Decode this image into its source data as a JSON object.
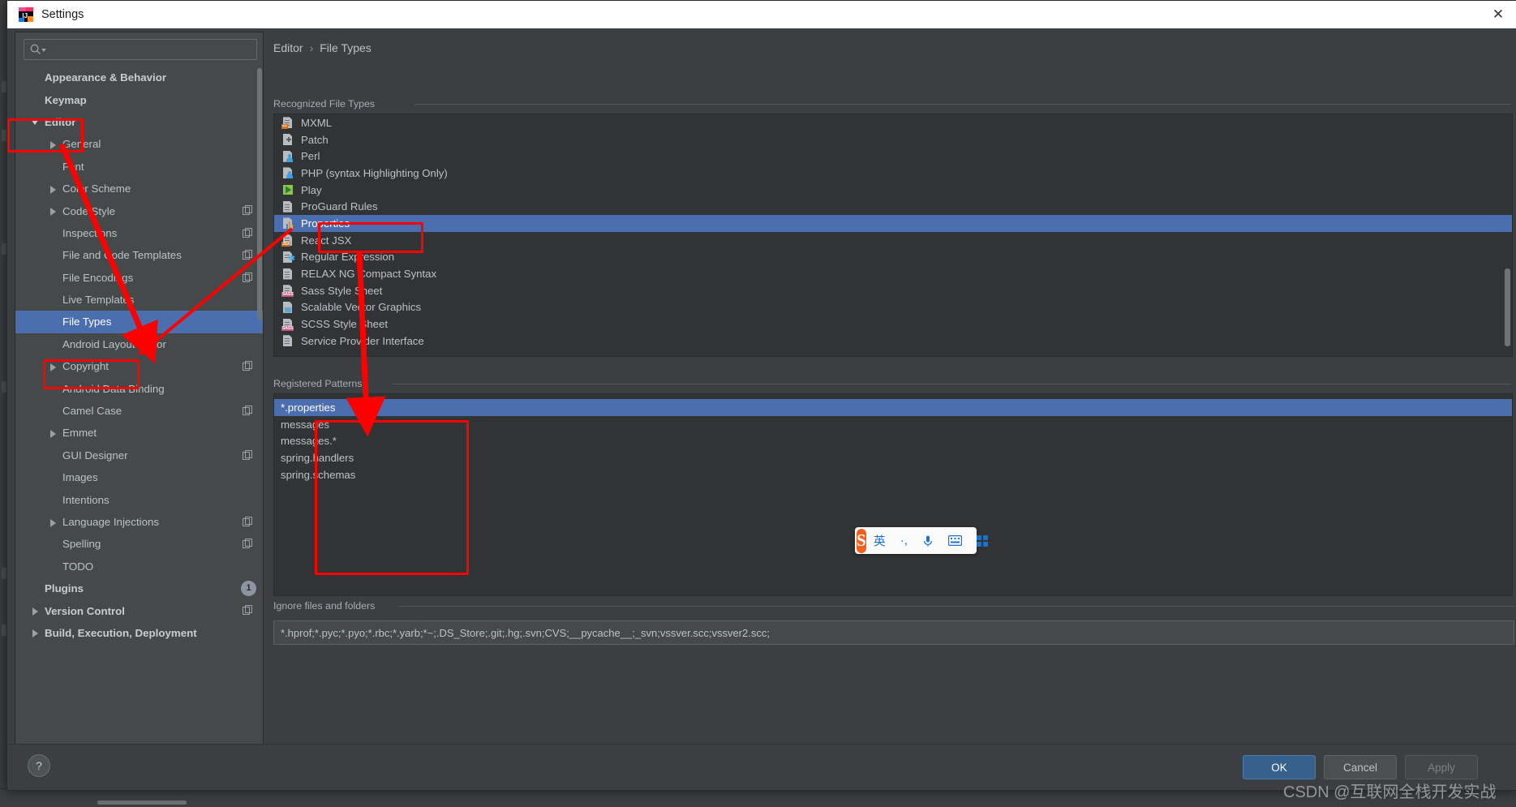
{
  "window": {
    "title": "Settings",
    "app_icon": "intellij-idea-icon",
    "close_icon": "close-icon"
  },
  "search": {
    "placeholder": "",
    "value": "",
    "icon": "search-icon"
  },
  "sidebar": {
    "items": [
      {
        "label": "Appearance & Behavior",
        "indent": 0,
        "bold": true,
        "arrow": "none",
        "copy": false
      },
      {
        "label": "Keymap",
        "indent": 0,
        "bold": true,
        "arrow": "none",
        "copy": false
      },
      {
        "label": "Editor",
        "indent": 0,
        "bold": true,
        "arrow": "down",
        "copy": false
      },
      {
        "label": "General",
        "indent": 1,
        "bold": false,
        "arrow": "right",
        "copy": false
      },
      {
        "label": "Font",
        "indent": 1,
        "bold": false,
        "arrow": "none",
        "copy": false
      },
      {
        "label": "Color Scheme",
        "indent": 1,
        "bold": false,
        "arrow": "right",
        "copy": false
      },
      {
        "label": "Code Style",
        "indent": 1,
        "bold": false,
        "arrow": "right",
        "copy": true
      },
      {
        "label": "Inspections",
        "indent": 1,
        "bold": false,
        "arrow": "none",
        "copy": true
      },
      {
        "label": "File and Code Templates",
        "indent": 1,
        "bold": false,
        "arrow": "none",
        "copy": true
      },
      {
        "label": "File Encodings",
        "indent": 1,
        "bold": false,
        "arrow": "none",
        "copy": true
      },
      {
        "label": "Live Templates",
        "indent": 1,
        "bold": false,
        "arrow": "none",
        "copy": false
      },
      {
        "label": "File Types",
        "indent": 1,
        "bold": false,
        "arrow": "none",
        "copy": false,
        "selected": true
      },
      {
        "label": "Android Layout Editor",
        "indent": 1,
        "bold": false,
        "arrow": "none",
        "copy": false
      },
      {
        "label": "Copyright",
        "indent": 1,
        "bold": false,
        "arrow": "right",
        "copy": true
      },
      {
        "label": "Android Data Binding",
        "indent": 1,
        "bold": false,
        "arrow": "none",
        "copy": false
      },
      {
        "label": "Camel Case",
        "indent": 1,
        "bold": false,
        "arrow": "none",
        "copy": true
      },
      {
        "label": "Emmet",
        "indent": 1,
        "bold": false,
        "arrow": "right",
        "copy": false
      },
      {
        "label": "GUI Designer",
        "indent": 1,
        "bold": false,
        "arrow": "none",
        "copy": true
      },
      {
        "label": "Images",
        "indent": 1,
        "bold": false,
        "arrow": "none",
        "copy": false
      },
      {
        "label": "Intentions",
        "indent": 1,
        "bold": false,
        "arrow": "none",
        "copy": false
      },
      {
        "label": "Language Injections",
        "indent": 1,
        "bold": false,
        "arrow": "right",
        "copy": true
      },
      {
        "label": "Spelling",
        "indent": 1,
        "bold": false,
        "arrow": "none",
        "copy": true
      },
      {
        "label": "TODO",
        "indent": 1,
        "bold": false,
        "arrow": "none",
        "copy": false
      },
      {
        "label": "Plugins",
        "indent": 0,
        "bold": true,
        "arrow": "none",
        "copy": false,
        "badge": "1"
      },
      {
        "label": "Version Control",
        "indent": 0,
        "bold": true,
        "arrow": "right",
        "copy": true
      },
      {
        "label": "Build, Execution, Deployment",
        "indent": 0,
        "bold": true,
        "arrow": "right",
        "copy": false
      }
    ]
  },
  "breadcrumb": {
    "parent": "Editor",
    "separator": "›",
    "current": "File Types"
  },
  "recognized": {
    "title": "Recognized File Types",
    "items": [
      {
        "label": "MXML",
        "icon": "mxml-file-icon",
        "tag": "<>",
        "tag_color": "#cf6a1b"
      },
      {
        "label": "Patch",
        "icon": "patch-file-icon",
        "tag": "",
        "tag_color": ""
      },
      {
        "label": "Perl",
        "icon": "perl-file-icon",
        "tag": "",
        "tag_color": ""
      },
      {
        "label": "PHP (syntax Highlighting Only)",
        "icon": "php-file-icon",
        "tag": "",
        "tag_color": ""
      },
      {
        "label": "Play",
        "icon": "play-file-icon",
        "tag": "",
        "tag_color": ""
      },
      {
        "label": "ProGuard Rules",
        "icon": "proguard-file-icon",
        "tag": "",
        "tag_color": ""
      },
      {
        "label": "Properties",
        "icon": "properties-file-icon",
        "tag": "",
        "tag_color": "",
        "selected": true
      },
      {
        "label": "React JSX",
        "icon": "jsx-file-icon",
        "tag": "JSX",
        "tag_color": "#cf6a1b"
      },
      {
        "label": "Regular Expression",
        "icon": "regex-file-icon",
        "tag": "",
        "tag_color": ""
      },
      {
        "label": "RELAX NG Compact Syntax",
        "icon": "relaxng-file-icon",
        "tag": "",
        "tag_color": ""
      },
      {
        "label": "Sass Style Sheet",
        "icon": "sass-file-icon",
        "tag": "SASS",
        "tag_color": "#c2557a"
      },
      {
        "label": "Scalable Vector Graphics",
        "icon": "svg-file-icon",
        "tag": "",
        "tag_color": ""
      },
      {
        "label": "SCSS Style Sheet",
        "icon": "scss-file-icon",
        "tag": "SASS",
        "tag_color": "#c2557a"
      },
      {
        "label": "Service Provider Interface",
        "icon": "spi-file-icon",
        "tag": "",
        "tag_color": ""
      }
    ],
    "buttons": [
      {
        "name": "add-file-type-button",
        "icon": "plus-icon"
      },
      {
        "name": "remove-file-type-button",
        "icon": "minus-icon"
      },
      {
        "name": "edit-file-type-button",
        "icon": "pencil-icon"
      }
    ]
  },
  "patterns": {
    "title": "Registered Patterns",
    "items": [
      {
        "label": "*.properties",
        "selected": true
      },
      {
        "label": "messages",
        "selected": false
      },
      {
        "label": "messages.*",
        "selected": false
      },
      {
        "label": "spring.handlers",
        "selected": false
      },
      {
        "label": "spring.schemas",
        "selected": false
      }
    ],
    "buttons": [
      {
        "name": "add-pattern-button",
        "icon": "plus-icon"
      },
      {
        "name": "remove-pattern-button",
        "icon": "minus-icon"
      },
      {
        "name": "edit-pattern-button",
        "icon": "pencil-icon"
      }
    ]
  },
  "ignore": {
    "title": "Ignore files and folders",
    "value": "*.hprof;*.pyc;*.pyo;*.rbc;*.yarb;*~;.DS_Store;.git;.hg;.svn;CVS;__pycache__;_svn;vssver.scc;vssver2.scc;"
  },
  "footer": {
    "help_icon": "help-icon",
    "ok": "OK",
    "cancel": "Cancel",
    "apply": "Apply"
  },
  "ime": {
    "logo": "S",
    "mode": "英",
    "punctuation": "·,",
    "voice_icon": "microphone-icon",
    "keyboard_icon": "keyboard-icon",
    "panel_icon": "grid-icon"
  },
  "watermark": "CSDN @互联网全栈开发实战",
  "colors": {
    "selection": "#4b6eaf",
    "annotation": "#fe0000",
    "dialog_bg": "#3c3f41",
    "list_bg": "#313335"
  }
}
